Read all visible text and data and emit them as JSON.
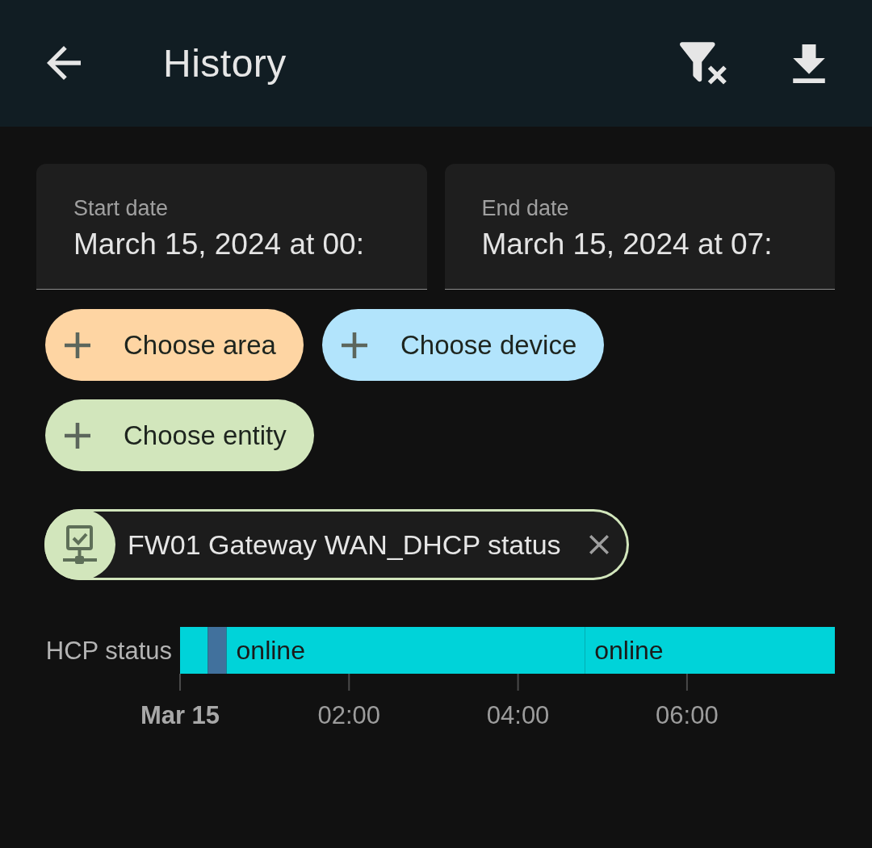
{
  "header": {
    "title": "History"
  },
  "date_range": [
    {
      "label": "Start date",
      "value": "March 15, 2024 at 00:"
    },
    {
      "label": "End date",
      "value": "March 15, 2024 at 07:"
    }
  ],
  "pickers": [
    {
      "label": "Choose area",
      "color": "#fed5a3"
    },
    {
      "label": "Choose device",
      "color": "#b2e4fc"
    },
    {
      "label": "Choose entity",
      "color": "#d2e6bc"
    }
  ],
  "selected_entities": [
    {
      "label": "FW01 Gateway WAN_DHCP status"
    }
  ],
  "history": {
    "chart_data": {
      "type": "bar",
      "orientation": "horizontal",
      "stacked": true,
      "categories": [
        "HCP status"
      ],
      "series": [
        {
          "color": "#00d3d9",
          "values": [
            0.33
          ]
        },
        {
          "color": "#41719d",
          "values": [
            0.22
          ]
        },
        {
          "name": "online",
          "color": "#00d3d9",
          "values": [
            4.24
          ]
        },
        {
          "name": "online",
          "color": "#00d3d9",
          "values": [
            2.96
          ]
        }
      ],
      "xlim": [
        0,
        7.75
      ],
      "xticks": [
        {
          "value": 0,
          "label": "Mar 15"
        },
        {
          "value": 2,
          "label": "02:00"
        },
        {
          "value": 4,
          "label": "04:00"
        },
        {
          "value": 6,
          "label": "06:00"
        }
      ]
    }
  }
}
